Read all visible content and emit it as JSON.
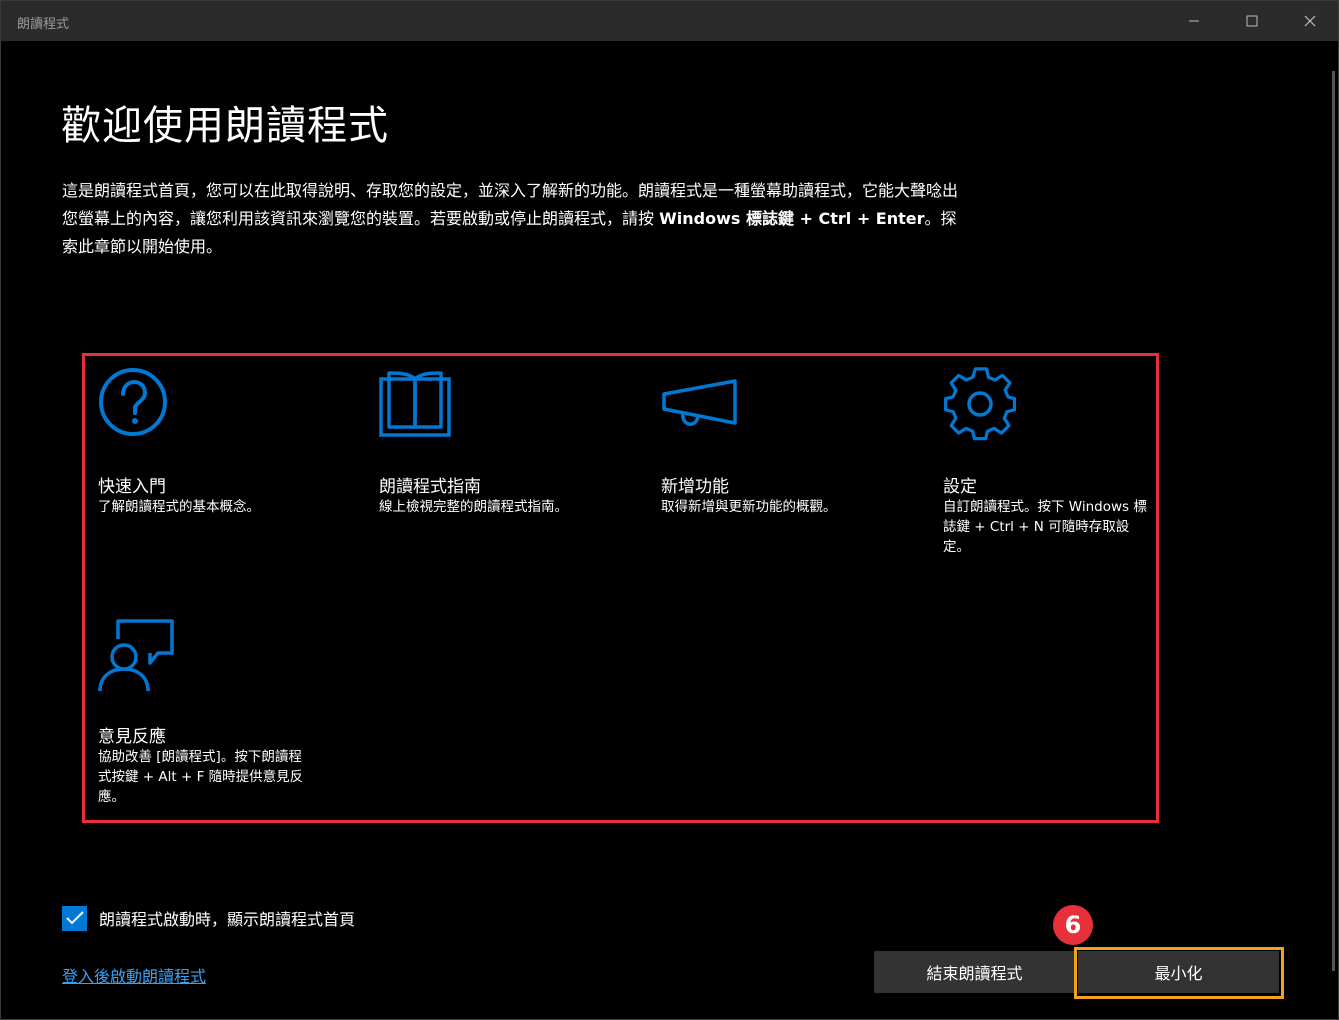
{
  "window": {
    "title": "朗讀程式"
  },
  "main": {
    "heading": "歡迎使用朗讀程式",
    "intro_part1": "這是朗讀程式首頁，您可以在此取得說明、存取您的設定，並深入了解新的功能。朗讀程式是一種螢幕助讀程式，它能大聲唸出您螢幕上的內容，讓您利用該資訊來瀏覽您的裝置。若要啟動或停止朗讀程式，請按 ",
    "intro_keys": "Windows 標誌鍵 + Ctrl + Enter",
    "intro_part2": "。探索此章節以開始使用。"
  },
  "cards": [
    {
      "icon": "question-circle-icon",
      "title": "快速入門",
      "description": "了解朗讀程式的基本概念。"
    },
    {
      "icon": "open-book-icon",
      "title": "朗讀程式指南",
      "description": "線上檢視完整的朗讀程式指南。"
    },
    {
      "icon": "megaphone-icon",
      "title": "新增功能",
      "description": "取得新增與更新功能的概觀。"
    },
    {
      "icon": "gear-icon",
      "title": "設定",
      "description": "自訂朗讀程式。按下 Windows 標誌鍵 + Ctrl + N 可隨時存取設定。"
    },
    {
      "icon": "feedback-person-icon",
      "title": "意見反應",
      "description": "協助改善 [朗讀程式]。按下朗讀程式按鍵 + Alt + F 隨時提供意見反應。"
    }
  ],
  "footer": {
    "show_home_checkbox_label": "朗讀程式啟動時，顯示朗讀程式首頁",
    "show_home_checked": true,
    "signin_link": "登入後啟動朗讀程式",
    "exit_button": "結束朗讀程式",
    "minimize_button": "最小化"
  },
  "annotations": {
    "step_badge": "6",
    "highlight_color": "#e8303b",
    "button_highlight_color": "#f0a31b"
  },
  "colors": {
    "accent": "#0078d4",
    "link": "#3aa0f3",
    "background": "#000000",
    "titlebar": "#2b2b2b"
  }
}
